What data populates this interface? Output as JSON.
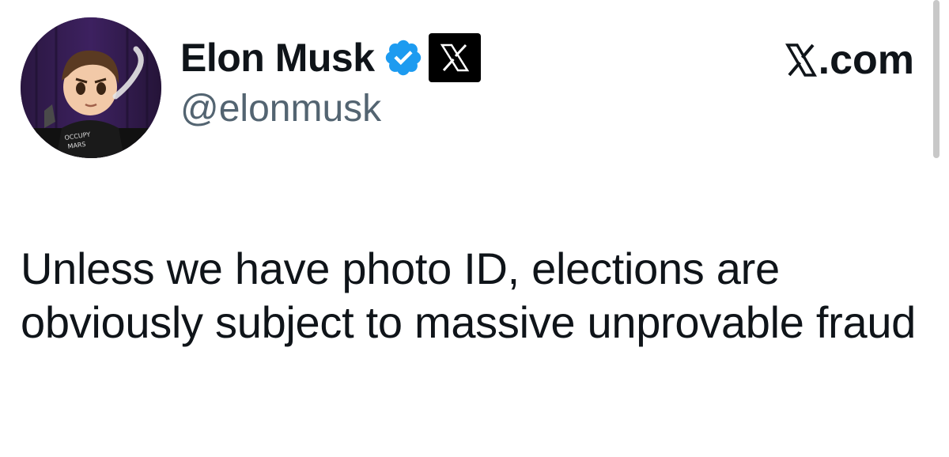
{
  "author": {
    "display_name": "Elon Musk",
    "handle": "@elonmusk",
    "verified_icon": "verified-badge-icon",
    "affiliate_icon": "x-logo-icon",
    "avatar_shirt_text": "OCCUPY MARS"
  },
  "site": {
    "label": ".com",
    "logo": "x-logo-icon"
  },
  "post": {
    "text": "Unless we have photo ID, elections are obviously subject to massive unprovable fraud"
  },
  "colors": {
    "verified_blue": "#1d9bf0",
    "handle_gray": "#536471",
    "text": "#0f1419"
  }
}
